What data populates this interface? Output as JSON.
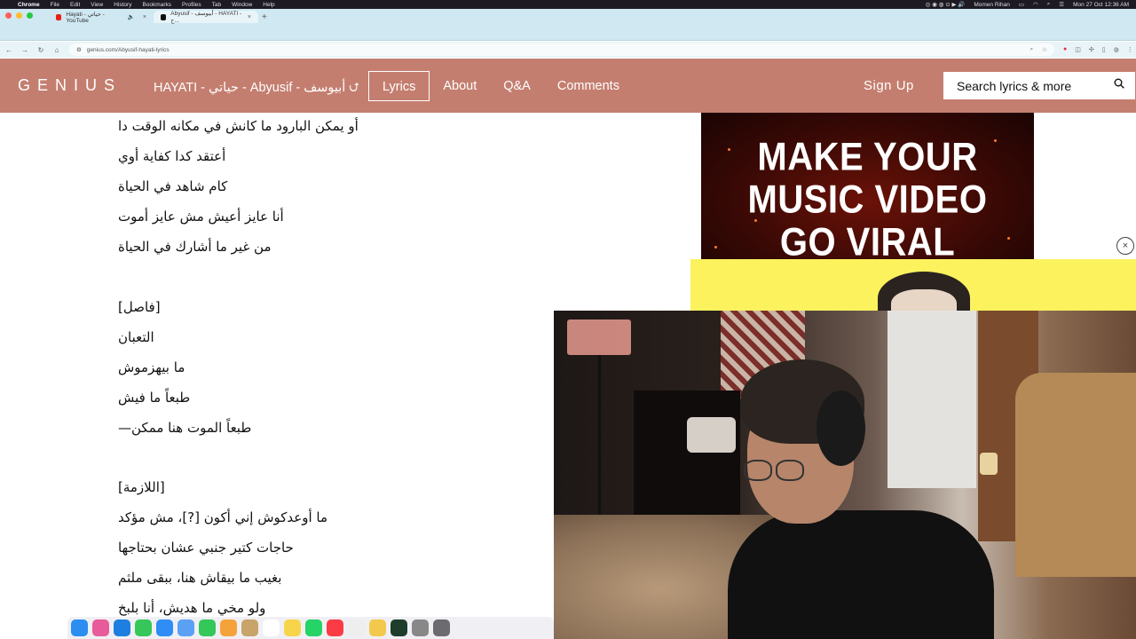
{
  "menubar": {
    "app": "Chrome",
    "menus": [
      "File",
      "Edit",
      "View",
      "History",
      "Bookmarks",
      "Profiles",
      "Tab",
      "Window",
      "Help"
    ],
    "user": "Momen Rihan",
    "datetime": "Mon 27 Oct  12:36 AM"
  },
  "browser": {
    "tabs": [
      {
        "title": "Hayati - حياتي - YouTube",
        "favicon_color": "#e62117"
      },
      {
        "title": "Abyusif - أبيوسف - HAYATI - ح...",
        "favicon_color": "#fffc64"
      }
    ],
    "url": "genius.com/Abyusif-hayati-lyrics"
  },
  "genius": {
    "logo": "GENIUS",
    "song_title": "HAYATI - حياتي - Abyusif - أبيوسف ⮍",
    "nav": [
      "Lyrics",
      "About",
      "Q&A",
      "Comments"
    ],
    "active_nav": "Lyrics",
    "sign_up": "Sign Up",
    "search_placeholder": "Search lyrics & more"
  },
  "lyrics": [
    "أو يمكن البارود ما كانش في مكانه الوقت دا",
    "أعتقد كدا كفاية أوي",
    "كام شاهد في الحياة",
    "أنا عايز أعيش مش عايز أموت",
    "من غير ما أشارك في الحياة",
    "",
    "[فاصل]",
    "التعبان",
    "ما بيهزموش",
    "طبعاً ما فيش",
    "طبعاً الموت هنا ممكن—",
    "",
    "[اللازمة]",
    "ما أوعدكوش إني أكون [?]، مش مؤكد",
    "حاجات كتير جنبي عشان بحتاجها",
    "بغيب ما بيقاش هنا، ببقى ملثم",
    "ولو مخي ما هديش، أنا بلبخ"
  ],
  "ad": {
    "lines": [
      "MAKE YOUR",
      "MUSIC VIDEO",
      "GO VIRAL"
    ],
    "close": "×"
  }
}
